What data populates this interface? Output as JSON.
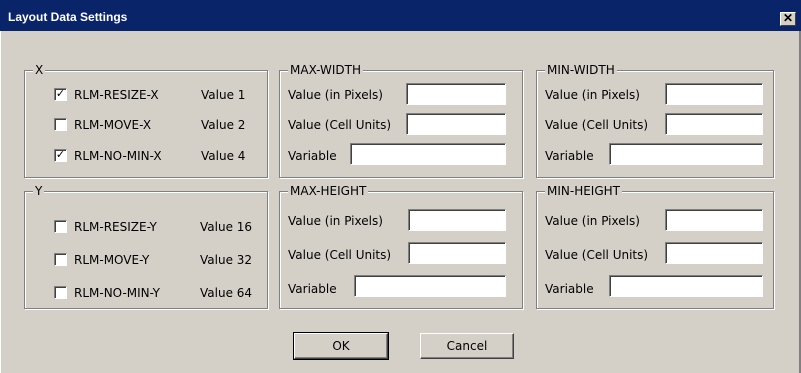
{
  "window": {
    "title": "Layout Data Settings",
    "close_glyph": "✕"
  },
  "x_group": {
    "legend": "X",
    "items": [
      {
        "label": "RLM-RESIZE-X",
        "checked": true,
        "value": "Value 1"
      },
      {
        "label": "RLM-MOVE-X",
        "checked": false,
        "value": "Value 2"
      },
      {
        "label": "RLM-NO-MIN-X",
        "checked": true,
        "value": "Value 4"
      }
    ]
  },
  "y_group": {
    "legend": "Y",
    "items": [
      {
        "label": "RLM-RESIZE-Y",
        "checked": false,
        "value": "Value 16"
      },
      {
        "label": "RLM-MOVE-Y",
        "checked": false,
        "value": "Value 32"
      },
      {
        "label": "RLM-NO-MIN-Y",
        "checked": false,
        "value": "Value 64"
      }
    ]
  },
  "max_width": {
    "legend": "MAX-WIDTH",
    "pixels_label": "Value (in Pixels)",
    "cells_label": "Value (Cell Units)",
    "variable_label": "Variable",
    "pixels_value": "",
    "cells_value": "",
    "variable_value": ""
  },
  "min_width": {
    "legend": "MIN-WIDTH",
    "pixels_label": "Value (in Pixels)",
    "cells_label": "Value (Cell Units)",
    "variable_label": "Variable",
    "pixels_value": "",
    "cells_value": "",
    "variable_value": ""
  },
  "max_height": {
    "legend": "MAX-HEIGHT",
    "pixels_label": "Value (in Pixels)",
    "cells_label": "Value (Cell Units)",
    "variable_label": "Variable",
    "pixels_value": "",
    "cells_value": "",
    "variable_value": ""
  },
  "min_height": {
    "legend": "MIN-HEIGHT",
    "pixels_label": "Value (in Pixels)",
    "cells_label": "Value (Cell Units)",
    "variable_label": "Variable",
    "pixels_value": "",
    "cells_value": "",
    "variable_value": ""
  },
  "buttons": {
    "ok": "OK",
    "cancel": "Cancel"
  },
  "colors": {
    "titlebar": "#0a246a",
    "face": "#d4d0c8"
  },
  "icons": {
    "checkmark": "✓"
  }
}
